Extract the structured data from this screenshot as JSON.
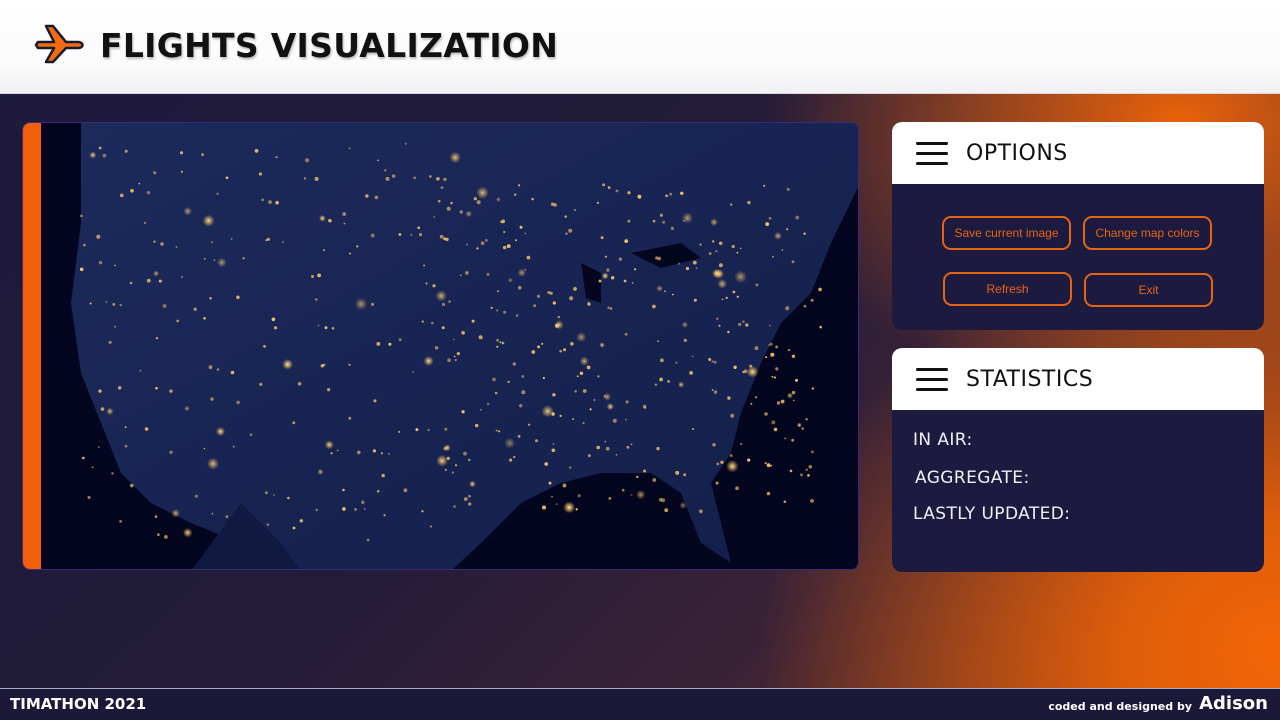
{
  "header": {
    "title": "FLIGHTS VISUALIZATION",
    "logo_icon": "airplane-icon"
  },
  "map": {
    "description_icon": "us-night-lights-map",
    "accent_color": "#f25f0a"
  },
  "options": {
    "title": "OPTIONS",
    "menu_icon": "hamburger-icon",
    "buttons": {
      "save_image": "Save current image",
      "change_colors": "Change map colors",
      "refresh": "Refresh",
      "exit": "Exit"
    }
  },
  "statistics": {
    "title": "STATISTICS",
    "menu_icon": "hamburger-icon",
    "in_air_label": "IN AIR:",
    "aggregate_label": "AGGREGATE:",
    "updated_label": "LASTLY UPDATED:"
  },
  "footer": {
    "event": "TIMATHON 2021",
    "credit_prefix": "coded and designed by",
    "author": "Adison"
  },
  "colors": {
    "accent": "#e66512",
    "panel": "#1d1a40",
    "header_bg": "#ffffff"
  }
}
